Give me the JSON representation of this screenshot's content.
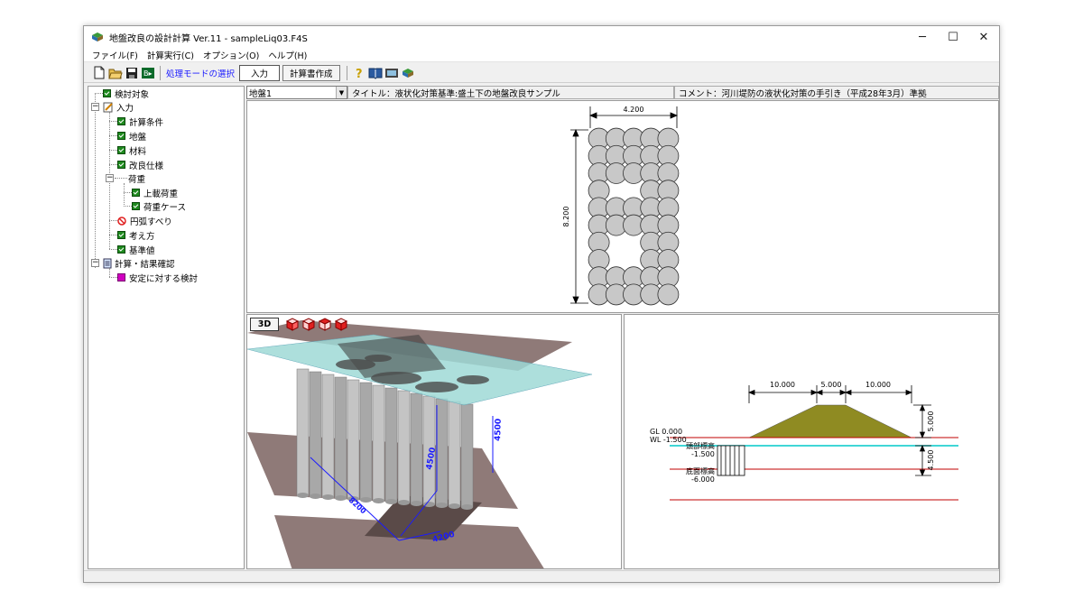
{
  "window": {
    "title": "地盤改良の設計計算 Ver.11 - sampleLiq03.F4S",
    "minimize": "─",
    "maximize": "☐",
    "close": "✕"
  },
  "menu": [
    "ファイル(F)",
    "計算実行(C)",
    "オプション(O)",
    "ヘルプ(H)"
  ],
  "toolbar": {
    "mode_label": "処理モードの選択",
    "input_button": "入力",
    "report_button": "計算書作成"
  },
  "tree": {
    "items": [
      {
        "label": "検討対象",
        "state": "checked"
      },
      {
        "label": "入力",
        "state": "folder"
      },
      {
        "label": "計算条件",
        "state": "checked"
      },
      {
        "label": "地盤",
        "state": "checked"
      },
      {
        "label": "材料",
        "state": "checked"
      },
      {
        "label": "改良仕様",
        "state": "checked"
      },
      {
        "label": "荷重",
        "state": "none"
      },
      {
        "label": "上載荷重",
        "state": "checked"
      },
      {
        "label": "荷重ケース",
        "state": "checked"
      },
      {
        "label": "円弧すべり",
        "state": "prohibited"
      },
      {
        "label": "考え方",
        "state": "checked"
      },
      {
        "label": "基準値",
        "state": "checked"
      },
      {
        "label": "計算・結果確認",
        "state": "doc"
      },
      {
        "label": "安定に対する検討",
        "state": "pink"
      }
    ]
  },
  "header": {
    "combo_value": "地盤1",
    "title_text": "タイトル：液状化対策基準:盛土下の地盤改良サンプル",
    "comment_text": "コメント：河川堤防の液状化対策の手引き（平成28年3月）準拠"
  },
  "plan_view": {
    "width_label": "4.200",
    "height_label": "8.200",
    "columns": 5,
    "rows": 10,
    "missing_cells": [
      [
        1,
        3
      ],
      [
        2,
        3
      ],
      [
        1,
        6
      ],
      [
        2,
        6
      ],
      [
        1,
        7
      ],
      [
        2,
        7
      ]
    ]
  },
  "view3d": {
    "button_label": "3D",
    "dim_depth": "4500",
    "dim_height": "4500",
    "dim_width": "4200",
    "dim_length": "8200"
  },
  "section_view": {
    "dim_left": "10.000",
    "dim_top": "5.000",
    "dim_right": "10.000",
    "dim_embank_height": "5.000",
    "dim_depth": "4.500",
    "gl_label": "GL 0.000",
    "wl_label": "WL -1.500",
    "top_label": "頭部標高",
    "top_value": "-1.500",
    "bottom_label": "底面標高",
    "bottom_value": "-6.000"
  },
  "colors": {
    "embankment": "#8f8b22",
    "water_line": "#00c8c8",
    "layer_line": "#c00000",
    "column_fill": "#c8c8c8",
    "check_green": "#1f8a1f",
    "plane_brown": "#8f7a78",
    "water_plane": "#9fd9d6"
  }
}
